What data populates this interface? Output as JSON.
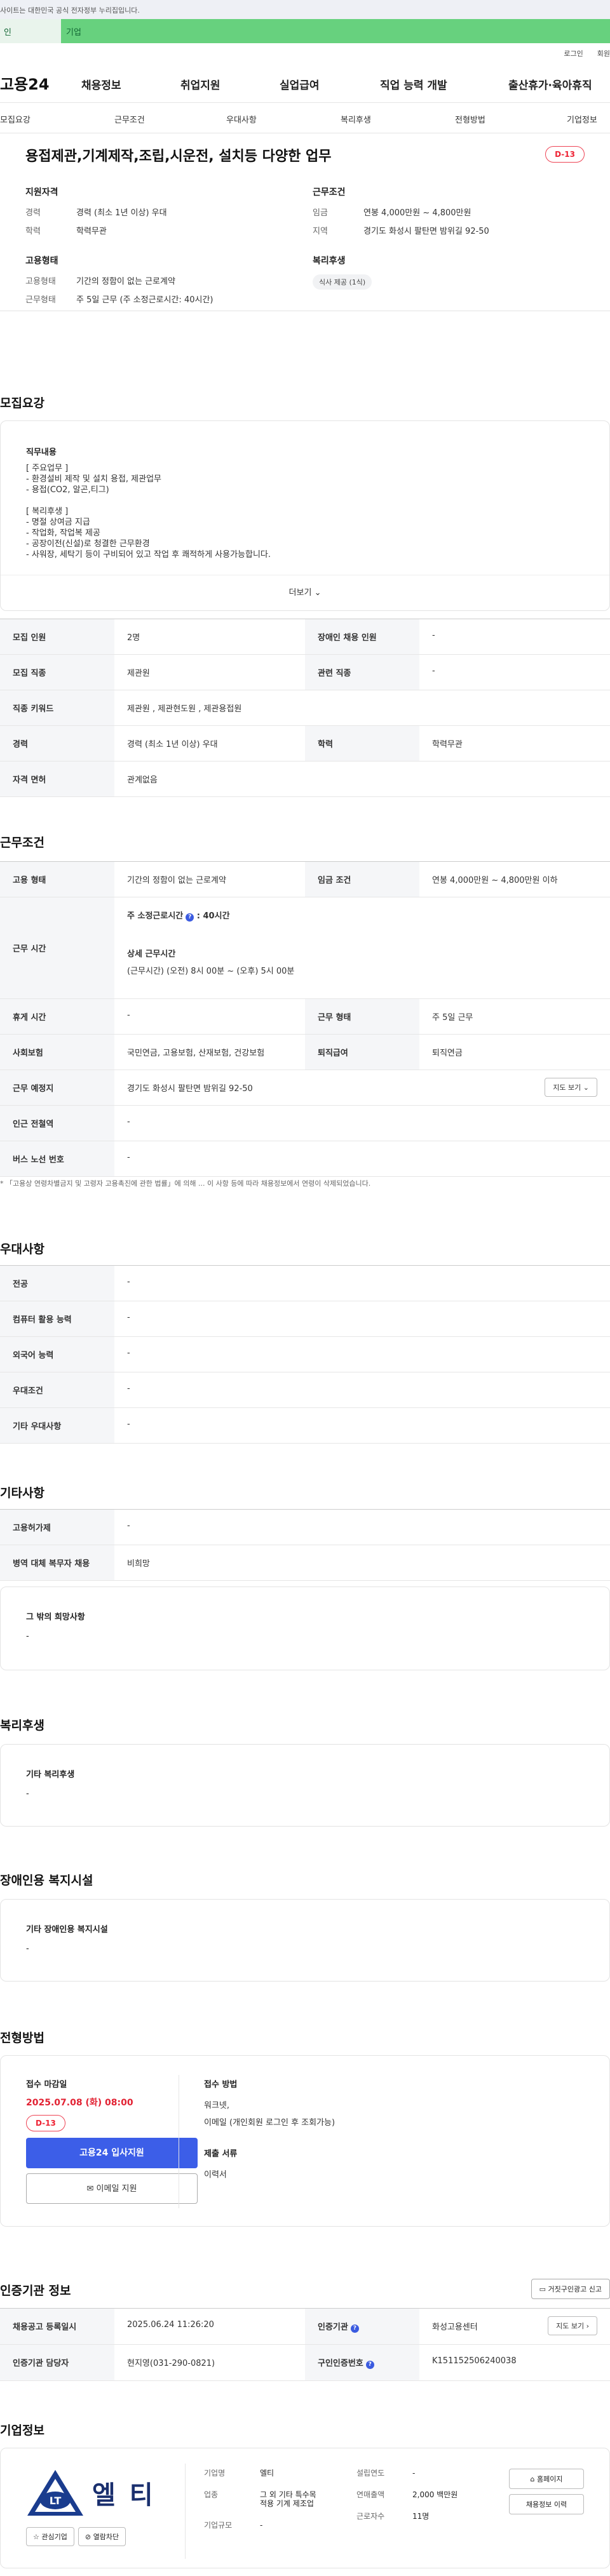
{
  "top_notice": "사이트는 대한민국 공식 전자정부 누리집입니다.",
  "greenbar": {
    "seg1": "인",
    "seg2": "기업"
  },
  "util": {
    "login": "로그인",
    "join": "회원"
  },
  "gnb": {
    "logo": "고용24",
    "menu": [
      "채용정보",
      "취업지원",
      "실업급여",
      "직업 능력 개발",
      "출산휴가·육아휴직"
    ]
  },
  "subnav": [
    "모집요강",
    "근무조건",
    "우대사항",
    "복리후생",
    "전형방법",
    "기업정보"
  ],
  "job": {
    "title": "용접제관,기계제작,조립,시운전, 설치등 다양한 업무",
    "dday": "D-13",
    "qual_h": "지원자격",
    "career_k": "경력",
    "career_v": "경력 (최소 1년 이상) 우대",
    "edu_k": "학력",
    "edu_v": "학력무관",
    "emp_h": "고용형태",
    "emptype_k": "고용형태",
    "emptype_v": "기간의 정함이 없는 근로계약",
    "worktype_k": "근무형태",
    "worktype_v": "주 5일 근무 (주 소정근로시간: 40시간)",
    "cond_h": "근무조건",
    "wage_k": "임금",
    "wage_v": "연봉 4,000만원 ~ 4,800만원",
    "region_k": "지역",
    "region_v": "경기도 화성시 팔탄면 밤위길 92-50",
    "welfare_h": "복리후생",
    "welfare_chip": "식사 제공 (1식)"
  },
  "recruit": {
    "heading": "모집요강",
    "duty_h": "직무내용",
    "duty_lines": [
      "[ 주요업무 ]",
      "- 환경설비 제작 및 설치 용접, 제관업무",
      "- 용접(CO2, 알곤,티그)",
      "",
      "[ 복리후생 ]",
      "- 명절 상여금 지급",
      "- 작업화, 작업복 제공",
      "- 공장이전(신설)로 청결한 근무환경",
      "- 사워장, 세탁기 등이 구비되어 있고 작업 후 쾌적하게 사용가능합니다."
    ],
    "more": "더보기",
    "rows": {
      "count_k": "모집 인원",
      "count_v": "2명",
      "disab_k": "장애인 채용 인원",
      "disab_v": "-",
      "job_k": "모집 직종",
      "job_v": "제관원",
      "related_k": "관련 직종",
      "related_v": "-",
      "kw_k": "직종 키워드",
      "kw_v": "제관원 , 제관현도원 , 제관용접원",
      "career_k": "경력",
      "career_v": "경력 (최소 1년 이상) 우대",
      "edu_k": "학력",
      "edu_v": "학력무관",
      "license_k": "자격 면허",
      "license_v": "관계없음"
    }
  },
  "work": {
    "heading": "근무조건",
    "emp_k": "고용 형태",
    "emp_v": "기간의 정함이 없는 근로계약",
    "wage_k": "임금 조건",
    "wage_v": "연봉 4,000만원 ~ 4,800만원 이하",
    "hours_k": "근무 시간",
    "std_label": "주 소정근로시간",
    "std_v": "40시간",
    "detail_label": "상세 근무시간",
    "detail_v": "(근무시간) (오전) 8시 00분 ~ (오후) 5시 00분",
    "rest_k": "휴게 시간",
    "rest_v": "-",
    "form_k": "근무 형태",
    "form_v": "주 5일 근무",
    "ins_k": "사회보험",
    "ins_v": "국민연금, 고용보험, 산재보험, 건강보험",
    "retire_k": "퇴직급여",
    "retire_v": "퇴직연금",
    "place_k": "근무 예정지",
    "place_v": "경기도 화성시 팔탄면 밤위길 92-50",
    "map_btn": "지도 보기",
    "subway_k": "인근 전철역",
    "subway_v": "-",
    "bus_k": "버스 노선 번호",
    "bus_v": "-",
    "note": "* 「고용상 연령차별금지 및 고령자 고용촉진에 관한 법률」에 의해 ... 이 사항 등에 따라 채용정보에서 연령이 삭제되었습니다."
  },
  "pref": {
    "heading": "우대사항",
    "rows": [
      [
        "전공",
        "-"
      ],
      [
        "컴퓨터 활용 능력",
        "-"
      ],
      [
        "외국어 능력",
        "-"
      ],
      [
        "우대조건",
        "-"
      ],
      [
        "기타 우대사항",
        "-"
      ]
    ]
  },
  "etc": {
    "heading": "기타사항",
    "rows": [
      [
        "고용허가제",
        "-"
      ],
      [
        "병역 대체 복무자 채용",
        "비희망"
      ]
    ],
    "other_h": "그 밖의 희망사항",
    "other_v": "-"
  },
  "welfare": {
    "heading": "복리후생",
    "box_h": "기타 복리후생",
    "box_v": "-"
  },
  "disab": {
    "heading": "장애인용 복지시설",
    "box_h": "기타 장애인용 복지시설",
    "box_v": "-"
  },
  "screening": {
    "heading": "전형방법",
    "deadline_h": "접수 마감일",
    "deadline_v": "2025.07.08 (화) 08:00",
    "dday": "D-13",
    "apply": "고용24 입사지원",
    "email": "이메일 지원",
    "method_h": "접수 방법",
    "method_v1": "워크넷,",
    "method_v2": "이메일 (개인회원 로그인 후 조회가능)",
    "docs_h": "제출 서류",
    "docs_v": "이력서"
  },
  "cert": {
    "heading": "인증기관 정보",
    "report_btn": "거짓구인광고 신고",
    "date_k": "채용공고 등록일시",
    "date_v": "2025.06.24 11:26:20",
    "org_k": "인증기관",
    "org_v": "화성고용센터",
    "map_btn": "지도 보기",
    "mgr_k": "인증기관 담당자",
    "mgr_v": "현지영(031-290-0821)",
    "num_k": "구인인증번호",
    "num_v": "K151152506240038"
  },
  "company": {
    "heading": "기업정보",
    "logo_text": "엘 티",
    "logo_mark": "LT",
    "fav": "관심기업",
    "block": "열람차단",
    "name_k": "기업명",
    "name_v": "엘티",
    "ind_k": "업종",
    "ind_v1": "그 외 기타 특수목",
    "ind_v2": "적용 기계 제조업",
    "size_k": "기업규모",
    "size_v": "-",
    "year_k": "설립연도",
    "year_v": "-",
    "sales_k": "연매출액",
    "sales_v": "2,000 백만원",
    "emp_k": "근로자수",
    "emp_v": "11명",
    "home_btn": "홈페이지",
    "jobs_btn": "채용정보 이력"
  },
  "colors": {
    "accent": "#3c5ee8",
    "green": "#67d17e",
    "dday": "#e22233"
  }
}
